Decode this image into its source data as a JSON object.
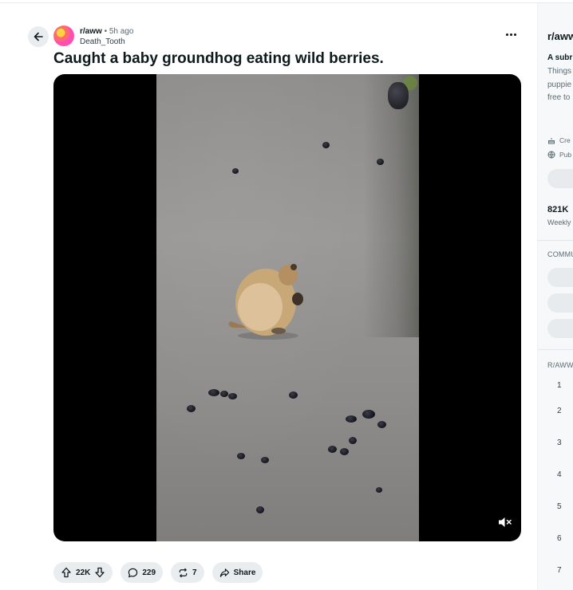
{
  "post": {
    "subreddit": "r/aww",
    "separator": "•",
    "time": "5h ago",
    "author": "Death_Tooth",
    "title": "Caught a baby groundhog eating wild berries."
  },
  "icons": {
    "back": "arrow-left-icon",
    "more": "more-horizontal-icon",
    "upvote": "arrow-up-icon",
    "downvote": "arrow-down-icon",
    "comments": "speech-bubble-icon",
    "crosspost": "repost-icon",
    "share": "share-arrow-icon",
    "mute": "speaker-muted-icon"
  },
  "video": {
    "muted": true
  },
  "actions": {
    "votes": "22K",
    "comments": "229",
    "crossposts": "7",
    "share_label": "Share"
  },
  "sidebar": {
    "title": "r/aww",
    "tagline": "A subr",
    "desc_lines": [
      "Things",
      "puppie",
      "free to"
    ],
    "created_label": "Cre",
    "visibility_label": "Pub",
    "members": "821K",
    "members_label": "Weekly",
    "community_header": "COMMU",
    "rules_header": "R/AWW",
    "rules": [
      "1",
      "2",
      "3",
      "4",
      "5",
      "6",
      "7"
    ]
  },
  "colors": {
    "pill_bg": "#eaedef",
    "sidebar_bg": "#f6f8f9",
    "text": "#0f1a1c",
    "muted_text": "#5c6c74"
  }
}
